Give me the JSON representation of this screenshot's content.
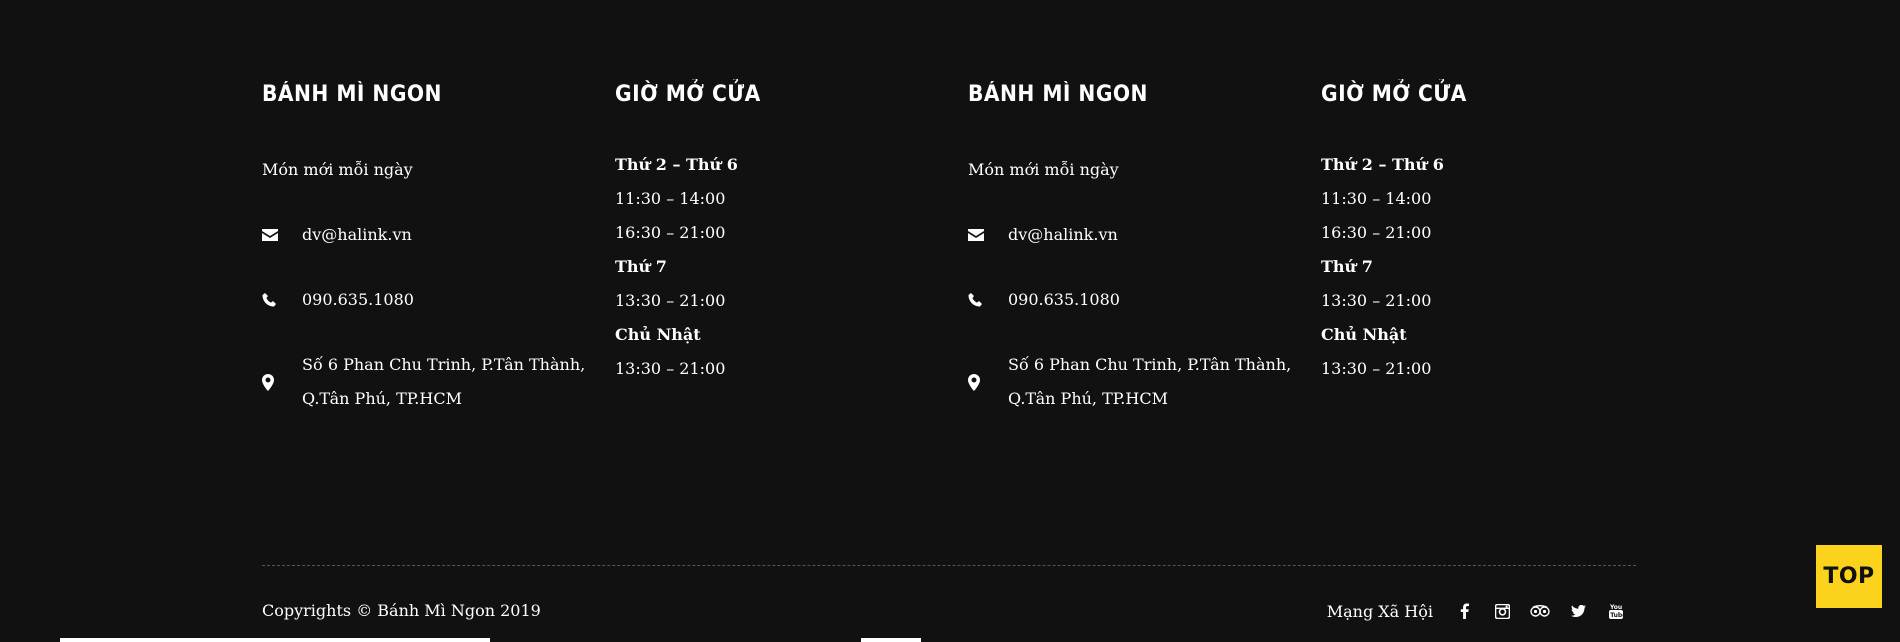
{
  "columns": [
    {
      "title": "BÁNH MÌ NGON",
      "tagline": "Món mới mỗi ngày",
      "email": "dv@halink.vn",
      "phone": "090.635.1080",
      "address_line1": "Số 6 Phan Chu Trinh, P.Tân Thành,",
      "address_line2": "Q.Tân Phú, TP.HCM"
    },
    {
      "title": "GIỜ MỞ CỬA",
      "hours": [
        {
          "text": "Thứ 2 – Thứ 6",
          "bold": true
        },
        {
          "text": "11:30 – 14:00",
          "bold": false
        },
        {
          "text": "16:30 – 21:00",
          "bold": false
        },
        {
          "text": "Thứ 7",
          "bold": true
        },
        {
          "text": "13:30 – 21:00",
          "bold": false
        },
        {
          "text": "Chủ Nhật",
          "bold": true
        },
        {
          "text": "13:30 – 21:00",
          "bold": false
        }
      ]
    },
    {
      "title": "BÁNH MÌ NGON",
      "tagline": "Món mới mỗi ngày",
      "email": "dv@halink.vn",
      "phone": "090.635.1080",
      "address_line1": "Số 6 Phan Chu Trinh, P.Tân Thành,",
      "address_line2": "Q.Tân Phú, TP.HCM"
    },
    {
      "title": "GIỜ MỞ CỬA",
      "hours": [
        {
          "text": "Thứ 2 – Thứ 6",
          "bold": true
        },
        {
          "text": "11:30 – 14:00",
          "bold": false
        },
        {
          "text": "16:30 – 21:00",
          "bold": false
        },
        {
          "text": "Thứ 7",
          "bold": true
        },
        {
          "text": "13:30 – 21:00",
          "bold": false
        },
        {
          "text": "Chủ Nhật",
          "bold": true
        },
        {
          "text": "13:30 – 21:00",
          "bold": false
        }
      ]
    }
  ],
  "bottom": {
    "copyright": "Copyrights © Bánh Mì Ngon 2019",
    "social_label": "Mạng Xã Hội",
    "social_icons": [
      "facebook-icon",
      "instagram-icon",
      "tripadvisor-icon",
      "twitter-icon",
      "youtube-icon"
    ]
  },
  "top_button": "TOP",
  "colors": {
    "background": "#111111",
    "text": "#ffffff",
    "accent": "#fcd31c"
  }
}
